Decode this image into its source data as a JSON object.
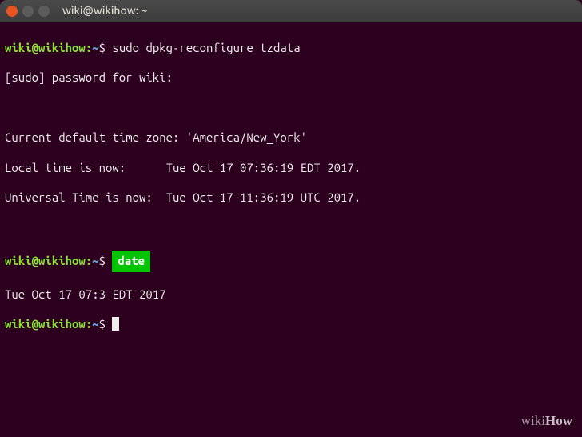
{
  "window": {
    "title": "wiki@wikihow: ~"
  },
  "prompt": {
    "user_host": "wiki@wikihow",
    "sep": ":",
    "path": "~",
    "symbol": "$"
  },
  "lines": {
    "cmd1": "sudo dpkg-reconfigure tzdata",
    "out_sudo": "[sudo] password for wiki:",
    "out_tz": "Current default time zone: 'America/New_York'",
    "out_local": "Local time is now:      Tue Oct 17 07:36:19 EDT 2017.",
    "out_utc": "Universal Time is now:  Tue Oct 17 11:36:19 UTC 2017.",
    "cmd2_highlight": "date",
    "out_date_pre": "Tue Oct 17 07:3",
    "out_date_post": " EDT 2017"
  },
  "watermark": {
    "wiki": "wiki",
    "how": "How"
  }
}
